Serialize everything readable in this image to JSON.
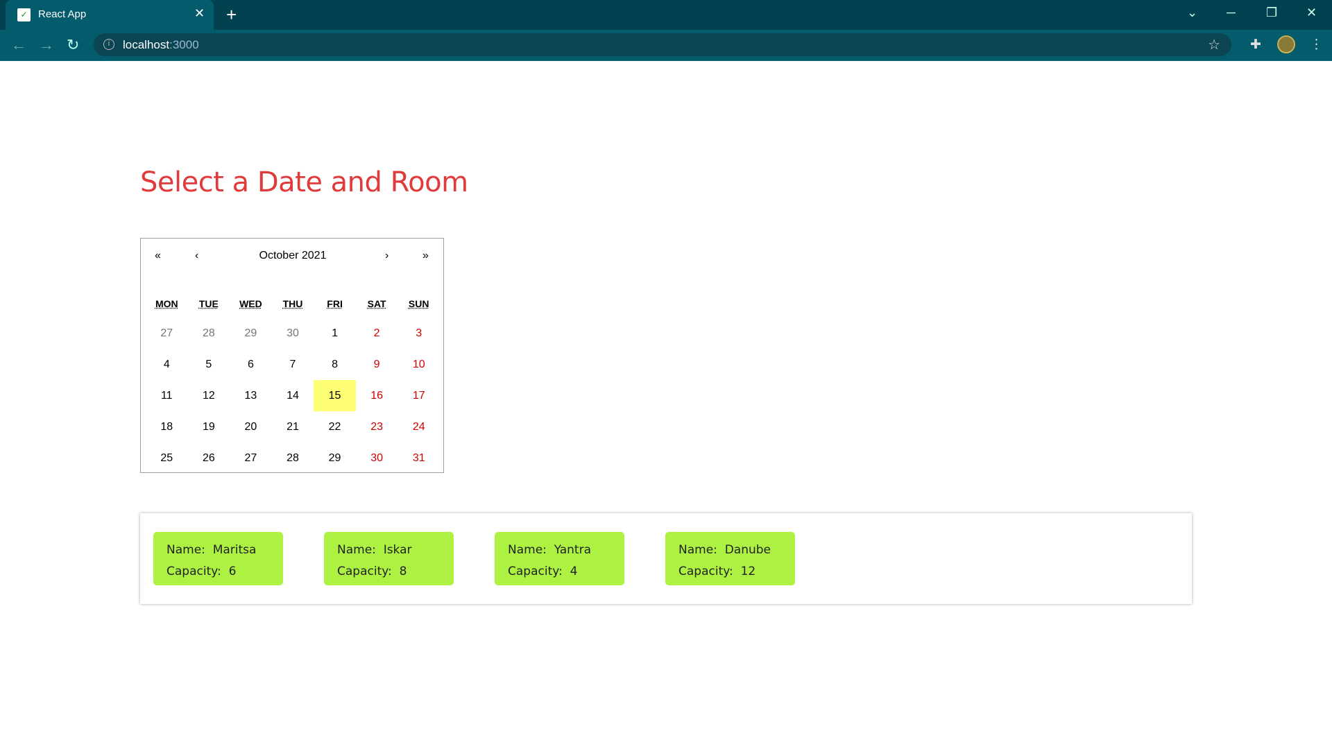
{
  "browser": {
    "tab_title": "React App",
    "url_host": "localhost",
    "url_port": ":3000"
  },
  "page": {
    "title": "Select a Date and Room"
  },
  "calendar": {
    "nav": {
      "prev_year": "«",
      "prev_month": "‹",
      "next_month": "›",
      "next_year": "»"
    },
    "month_label": "October 2021",
    "weekdays": [
      "MON",
      "TUE",
      "WED",
      "THU",
      "FRI",
      "SAT",
      "SUN"
    ],
    "selected_day": "15",
    "weeks": [
      [
        {
          "d": "27",
          "t": "other"
        },
        {
          "d": "28",
          "t": "other"
        },
        {
          "d": "29",
          "t": "other"
        },
        {
          "d": "30",
          "t": "other"
        },
        {
          "d": "1",
          "t": ""
        },
        {
          "d": "2",
          "t": "weekend"
        },
        {
          "d": "3",
          "t": "weekend"
        }
      ],
      [
        {
          "d": "4",
          "t": ""
        },
        {
          "d": "5",
          "t": ""
        },
        {
          "d": "6",
          "t": ""
        },
        {
          "d": "7",
          "t": ""
        },
        {
          "d": "8",
          "t": ""
        },
        {
          "d": "9",
          "t": "weekend"
        },
        {
          "d": "10",
          "t": "weekend"
        }
      ],
      [
        {
          "d": "11",
          "t": ""
        },
        {
          "d": "12",
          "t": ""
        },
        {
          "d": "13",
          "t": ""
        },
        {
          "d": "14",
          "t": ""
        },
        {
          "d": "15",
          "t": "selected"
        },
        {
          "d": "16",
          "t": "weekend"
        },
        {
          "d": "17",
          "t": "weekend"
        }
      ],
      [
        {
          "d": "18",
          "t": ""
        },
        {
          "d": "19",
          "t": ""
        },
        {
          "d": "20",
          "t": ""
        },
        {
          "d": "21",
          "t": ""
        },
        {
          "d": "22",
          "t": ""
        },
        {
          "d": "23",
          "t": "weekend"
        },
        {
          "d": "24",
          "t": "weekend"
        }
      ],
      [
        {
          "d": "25",
          "t": ""
        },
        {
          "d": "26",
          "t": ""
        },
        {
          "d": "27",
          "t": ""
        },
        {
          "d": "28",
          "t": ""
        },
        {
          "d": "29",
          "t": ""
        },
        {
          "d": "30",
          "t": "weekend"
        },
        {
          "d": "31",
          "t": "weekend"
        }
      ]
    ]
  },
  "rooms": [
    {
      "name_line": "Name:  Maritsa",
      "capacity_line": "Capacity:  6"
    },
    {
      "name_line": "Name:  Iskar",
      "capacity_line": "Capacity:  8"
    },
    {
      "name_line": "Name:  Yantra",
      "capacity_line": "Capacity:  4"
    },
    {
      "name_line": "Name:  Danube",
      "capacity_line": "Capacity:  12"
    }
  ],
  "colors": {
    "title": "#e03a3a",
    "room_card": "#adf242",
    "selected_day": "#ffff76",
    "weekend": "#d10000"
  }
}
